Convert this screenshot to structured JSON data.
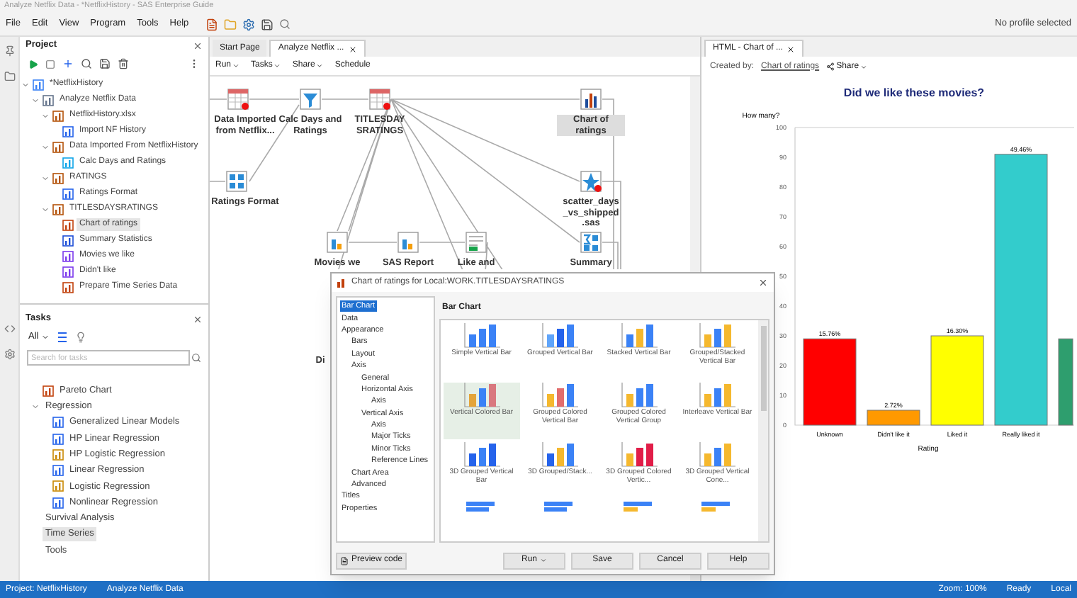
{
  "window": {
    "title": "Analyze Netflix Data - *NetflixHistory - SAS Enterprise Guide"
  },
  "menu": [
    "File",
    "Edit",
    "View",
    "Program",
    "Tools",
    "Help"
  ],
  "profile": "No profile selected",
  "project": {
    "title": "Project",
    "tree": [
      {
        "label": "*NetflixHistory",
        "kind": "project",
        "expanded": true,
        "selected": false,
        "children": [
          {
            "label": "Analyze Netflix Data",
            "kind": "flow",
            "expanded": true,
            "selected": false,
            "children": [
              {
                "label": "NetflixHistory.xlsx",
                "kind": "data",
                "expanded": true,
                "selected": false,
                "children": [
                  {
                    "label": "Import NF History",
                    "kind": "task",
                    "expanded": false,
                    "selected": false
                  }
                ]
              },
              {
                "label": "Data Imported From NetflixHistory",
                "kind": "data",
                "expanded": true,
                "selected": false,
                "children": [
                  {
                    "label": "Calc Days and Ratings",
                    "kind": "query",
                    "expanded": false,
                    "selected": false
                  }
                ]
              },
              {
                "label": "RATINGS",
                "kind": "data",
                "expanded": true,
                "selected": false,
                "children": [
                  {
                    "label": "Ratings Format",
                    "kind": "program",
                    "expanded": false,
                    "selected": false
                  }
                ]
              },
              {
                "label": "TITLESDAYSRATINGS",
                "kind": "data",
                "expanded": true,
                "selected": false,
                "children": [
                  {
                    "label": "Chart of ratings",
                    "kind": "chart",
                    "expanded": false,
                    "selected": true
                  },
                  {
                    "label": "Summary Statistics",
                    "kind": "stats",
                    "expanded": false,
                    "selected": false
                  },
                  {
                    "label": "Movies we like",
                    "kind": "report",
                    "expanded": false,
                    "selected": false
                  },
                  {
                    "label": "Didn't like",
                    "kind": "report",
                    "expanded": false,
                    "selected": false
                  },
                  {
                    "label": "Prepare Time Series Data",
                    "kind": "chart",
                    "expanded": false,
                    "selected": false
                  }
                ]
              }
            ]
          }
        ]
      }
    ]
  },
  "tasks": {
    "title": "Tasks",
    "filter": "All",
    "search": {
      "placeholder": "Search for tasks"
    },
    "items": [
      {
        "label": "Pareto Chart",
        "kind": "chart",
        "expanded": false,
        "selected": false
      },
      {
        "label": "Regression",
        "kind": "group",
        "expanded": true,
        "selected": false,
        "children": [
          {
            "label": "Generalized Linear Models",
            "kind": "line",
            "expanded": false,
            "selected": false
          },
          {
            "label": "HP Linear Regression",
            "kind": "line",
            "expanded": false,
            "selected": false
          },
          {
            "label": "HP Logistic Regression",
            "kind": "logit",
            "expanded": false,
            "selected": false
          },
          {
            "label": "Linear Regression",
            "kind": "line",
            "expanded": false,
            "selected": false
          },
          {
            "label": "Logistic Regression",
            "kind": "logit",
            "expanded": false,
            "selected": false
          },
          {
            "label": "Nonlinear Regression",
            "kind": "line",
            "expanded": false,
            "selected": false
          }
        ]
      },
      {
        "label": "Survival Analysis",
        "kind": "group",
        "expanded": false,
        "selected": false
      },
      {
        "label": "Time Series",
        "kind": "group",
        "expanded": false,
        "selected": true
      },
      {
        "label": "Tools",
        "kind": "group",
        "expanded": false,
        "selected": false
      }
    ]
  },
  "flow": {
    "tabs": [
      {
        "label": "Start Page",
        "selected": false
      },
      {
        "label": "Analyze Netflix ...",
        "selected": true
      }
    ],
    "toolbar": [
      {
        "label": "Run",
        "dropdown": true
      },
      {
        "label": "Tasks",
        "dropdown": true
      },
      {
        "label": "Share",
        "dropdown": true
      },
      {
        "label": "Schedule",
        "dropdown": false
      }
    ],
    "nodes": [
      {
        "label": "Data Imported from Netflix...",
        "kind": "data",
        "selected": false
      },
      {
        "label": "Calc Days and Ratings",
        "kind": "query",
        "selected": false
      },
      {
        "label": "TITLESDAY SRATINGS",
        "kind": "data",
        "selected": false
      },
      {
        "label": "Chart of ratings",
        "kind": "chart",
        "selected": true
      },
      {
        "label": "Ratings Format",
        "kind": "program",
        "selected": false
      },
      {
        "label": "scatter_days _vs_shipped .sas",
        "kind": "scatter",
        "selected": false
      },
      {
        "label": "Movies we",
        "kind": "report",
        "selected": false
      },
      {
        "label": "SAS Report",
        "kind": "report",
        "selected": false
      },
      {
        "label": "Like and",
        "kind": "export",
        "selected": false
      },
      {
        "label": "Summary",
        "kind": "stats",
        "selected": false
      },
      {
        "label": "Di",
        "kind": "hidden",
        "selected": false
      }
    ]
  },
  "results": {
    "tab": {
      "label": "HTML - Chart of ...",
      "selected": true
    },
    "created_by": "Created by:",
    "created_by_link": "Chart of ratings",
    "share": "Share",
    "chart_data": {
      "type": "bar",
      "title": "Did we like these movies?",
      "xlabel": "Rating",
      "ylabel": "How many?",
      "categories": [
        "Unknown",
        "Didn't like it",
        "Liked it",
        "Really liked it",
        null
      ],
      "series": [
        {
          "values": [
            29,
            5,
            30,
            91,
            29
          ]
        }
      ],
      "colors": [
        "#ff0000",
        "#ff9900",
        "#ffff00",
        "#33cccc",
        "#2e9e6e"
      ],
      "ylim": [
        0,
        100
      ],
      "yticks": [
        0,
        10,
        20,
        30,
        40,
        50,
        60,
        70,
        80,
        90,
        100
      ],
      "value_labels": [
        "15.76%",
        "2.72%",
        "16.30%",
        "49.46%",
        null
      ]
    }
  },
  "dialog": {
    "title": "Chart of ratings for Local:WORK.TITLESDAYSRATINGS",
    "tree": [
      {
        "label": "Bar Chart",
        "selected": true
      },
      {
        "label": "Data",
        "selected": false
      },
      {
        "label": "Appearance",
        "selected": false,
        "children": [
          {
            "label": "Bars",
            "selected": false
          },
          {
            "label": "Layout",
            "selected": false
          },
          {
            "label": "Axis",
            "selected": false,
            "children": [
              {
                "label": "General",
                "selected": false
              },
              {
                "label": "Horizontal Axis",
                "selected": false,
                "children": [
                  {
                    "label": "Axis",
                    "selected": false
                  }
                ]
              },
              {
                "label": "Vertical Axis",
                "selected": false,
                "children": [
                  {
                    "label": "Axis",
                    "selected": false
                  },
                  {
                    "label": "Major Ticks",
                    "selected": false
                  },
                  {
                    "label": "Minor Ticks",
                    "selected": false
                  },
                  {
                    "label": "Reference Lines",
                    "selected": false
                  }
                ]
              }
            ]
          },
          {
            "label": "Chart Area",
            "selected": false
          },
          {
            "label": "Advanced",
            "selected": false
          }
        ]
      },
      {
        "label": "Titles",
        "selected": false
      },
      {
        "label": "Properties",
        "selected": false
      }
    ],
    "heading": "Bar Chart",
    "gallery": [
      {
        "label": "Simple Vertical Bar",
        "selected": false
      },
      {
        "label": "Grouped Vertical Bar",
        "selected": false
      },
      {
        "label": "Stacked Vertical Bar",
        "selected": false
      },
      {
        "label": "Grouped/Stacked Vertical Bar",
        "selected": false
      },
      {
        "label": "Vertical Colored Bar",
        "selected": true
      },
      {
        "label": "Grouped Colored Vertical Bar",
        "selected": false
      },
      {
        "label": "Grouped Colored Vertical Group",
        "selected": false
      },
      {
        "label": "Interleave Vertical Bar",
        "selected": false
      },
      {
        "label": "3D Grouped Vertical Bar",
        "selected": false
      },
      {
        "label": "3D Grouped/Stack...",
        "selected": false
      },
      {
        "label": "3D Grouped Colored Vertic...",
        "selected": false
      },
      {
        "label": "3D Grouped Vertical Cone...",
        "selected": false
      }
    ],
    "buttons": [
      {
        "label": "Preview code",
        "kind": "icon"
      },
      {
        "label": "Run",
        "kind": "split"
      },
      {
        "label": "Save",
        "kind": "plain"
      },
      {
        "label": "Cancel",
        "kind": "plain"
      },
      {
        "label": "Help",
        "kind": "plain"
      }
    ]
  },
  "status_bar": {
    "left": [
      "Project: NetflixHistory",
      "Analyze Netflix Data"
    ],
    "right": [
      "Zoom: 100%",
      "Ready",
      "Local"
    ]
  }
}
